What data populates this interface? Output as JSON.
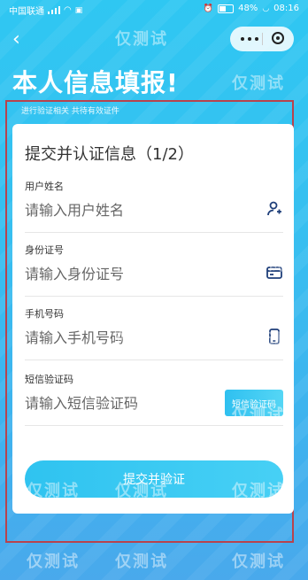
{
  "status_bar": {
    "carrier": "中国联通",
    "battery": "48%",
    "time": "08:16"
  },
  "nav": {
    "back_label": "‹"
  },
  "header": {
    "title": "本人信息填报!",
    "subtitle": "进行验证相关 共待有效证件"
  },
  "form": {
    "title": "提交并认证信息（1/2）",
    "fields": [
      {
        "label": "用户姓名",
        "placeholder": "请输入用户姓名",
        "icon": "user-add-icon"
      },
      {
        "label": "身份证号",
        "placeholder": "请输入身份证号",
        "icon": "id-card-icon"
      },
      {
        "label": "手机号码",
        "placeholder": "请输入手机号码",
        "icon": "phone-icon"
      },
      {
        "label": "短信验证码",
        "placeholder": "请输入短信验证码",
        "action": "短信验证码"
      }
    ],
    "submit_label": "提交并验证"
  },
  "watermark": "仅测试",
  "colors": {
    "accent": "#2fc3f0",
    "frame": "#b8434d",
    "bg_top": "#2fc7f2",
    "bg_bottom": "#49a9ec"
  }
}
